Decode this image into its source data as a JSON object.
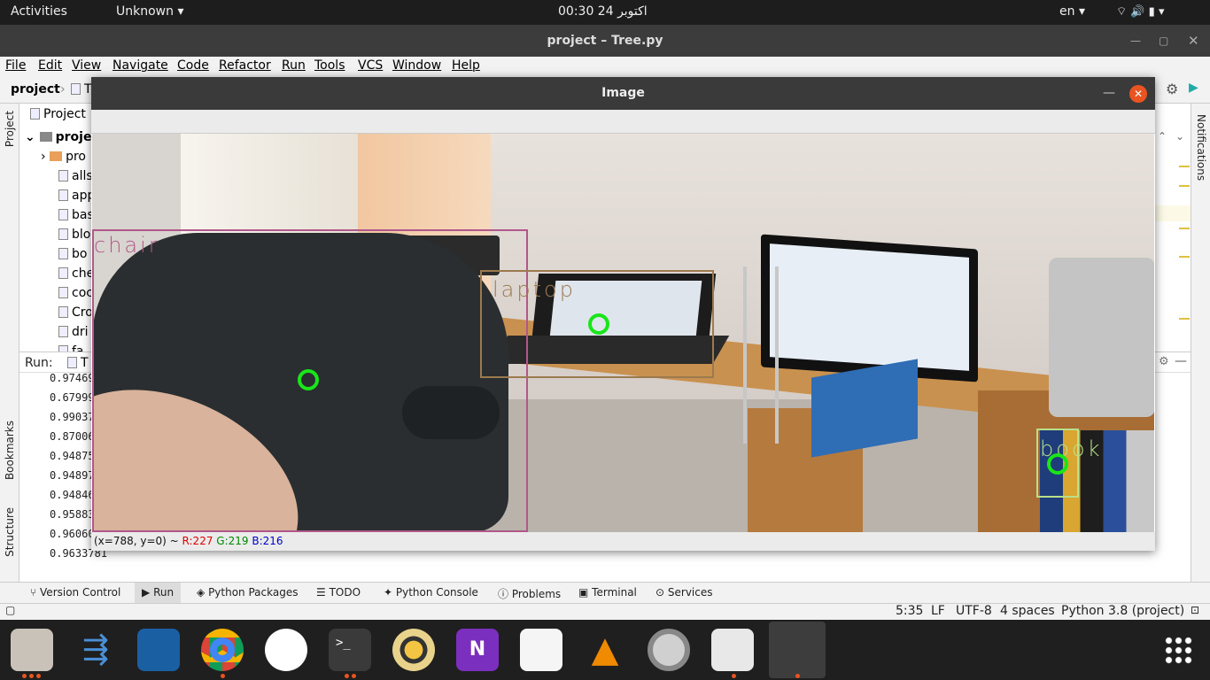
{
  "topbar": {
    "activities": "Activities",
    "app_menu": "Unknown",
    "clock": "00:30  24 اکتوبر",
    "lang": "en"
  },
  "ide": {
    "title": "project – Tree.py",
    "menu": [
      "File",
      "Edit",
      "View",
      "Navigate",
      "Code",
      "Refactor",
      "Run",
      "Tools",
      "VCS",
      "Window",
      "Help"
    ],
    "breadcrumb": "project",
    "breadcrumb_file": "T",
    "left_tool_project": "Project",
    "left_tool_bookmarks": "Bookmarks",
    "left_tool_structure": "Structure",
    "right_tool_notifications": "Notifications",
    "project_header": "Project",
    "tree": [
      "proje",
      "pro",
      "alls",
      "app",
      "bas",
      "blo",
      "bo",
      "che",
      "coc",
      "Cro",
      "dri",
      "fa"
    ],
    "run_label": "Run:",
    "run_tab": "T",
    "output": [
      "0.9746939",
      "0.6799939",
      "0.9903755",
      "0.8700681",
      "0.9487558",
      "0.9489792",
      "0.9484676",
      "0.9588348",
      "0.9606095",
      "0.9633781"
    ],
    "bottom_tabs": [
      "Version Control",
      "Run",
      "Python Packages",
      "TODO",
      "Python Console",
      "Problems",
      "Terminal",
      "Services"
    ],
    "status": {
      "position": "5:35",
      "line_sep": "LF",
      "encoding": "UTF-8",
      "indent": "4 spaces",
      "interpreter": "Python 3.8 (project)"
    }
  },
  "image_window": {
    "title": "Image",
    "status_coords": "(x=788, y=0) ~",
    "status_r": "R:227",
    "status_g": "G:219",
    "status_b": "B:216",
    "detections": [
      {
        "label": "chair",
        "color": "#b0588a"
      },
      {
        "label": "laptop",
        "color": "#9c7a4e"
      },
      {
        "label": "book",
        "color": "#b8e08a"
      }
    ]
  },
  "dock": {
    "apps": [
      "files-icon",
      "vscode-icon",
      "virtualbox-icon",
      "chrome-icon",
      "app-store-icon",
      "terminal-icon",
      "rhythmbox-icon",
      "onenote-icon",
      "text-editor-icon",
      "vlc-icon",
      "settings-icon",
      "java-icon",
      "active-window-icon"
    ]
  }
}
